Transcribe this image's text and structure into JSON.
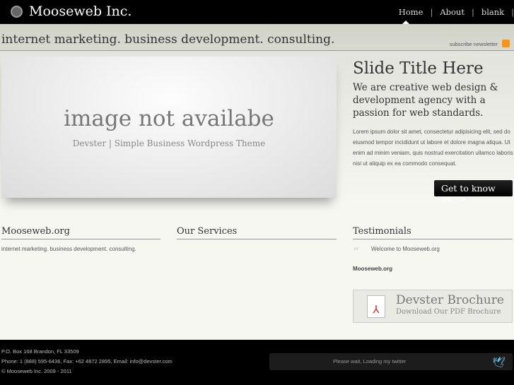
{
  "header": {
    "brand": "Mooseweb Inc.",
    "nav": [
      "Home",
      "About",
      "blank"
    ]
  },
  "band": {
    "tagline": "internet marketing. business development. consulting.",
    "subscribe": "subscribe newsletter"
  },
  "hero": {
    "image_title": "image not availabe",
    "image_subtitle": "Devster | Simple Business Wordpress Theme",
    "slide_title": "Slide Title Here",
    "slide_subtitle": "We are creative web design & development agency with a passion for web standards.",
    "lorem": "Lorem ipsum dolor sit amet, consectetur adipisicing elit, sed do eiusmod tempor incididunt ut labore et dolore magna aliqua. Ut enim ad minim veniam, quis nostrud exercitation ullamco laboris nisi ut aliquip ex ea commodo consequat.",
    "cta": "Get to know us",
    "cta_arrow": ">"
  },
  "columns": {
    "col1_title": "Mooseweb.org",
    "col1_text": "internet marketing. business development. consulting.",
    "col2_title": "Our Services",
    "col3_title": "Testimonials",
    "testimonial": "Welcome to Mooseweb.org",
    "testimonial_author": "Mooseweb.org"
  },
  "brochure": {
    "title": "Devster Brochure",
    "subtitle": "Download Our PDF Brochure"
  },
  "footer": {
    "address": "P.O. Box 168 Brandon, FL 33509",
    "contact": "Phone: 1 (888) 595-6436, Fax: +62 4872 2895, Email: info@devster.com",
    "copyright": "© Mooseweb Inc. 2009 - 2011",
    "twitter": "Please wait, Loading my twitter"
  }
}
